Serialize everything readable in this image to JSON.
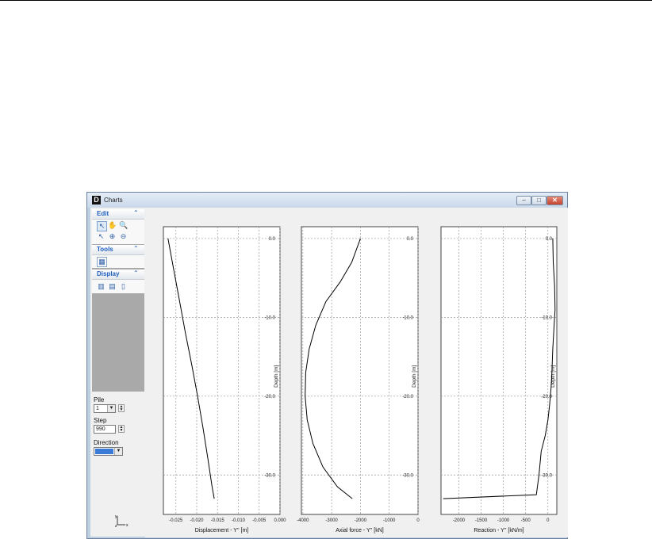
{
  "window": {
    "title": "Charts"
  },
  "panels": {
    "edit": {
      "label": "Edit",
      "chevron": "⌃"
    },
    "tools": {
      "label": "Tools",
      "chevron": "⌃"
    },
    "display": {
      "label": "Display",
      "chevron": "⌃"
    }
  },
  "controls": {
    "pile": {
      "label": "Pile",
      "value": "1"
    },
    "step": {
      "label": "Step",
      "value": "990"
    },
    "direction": {
      "label": "Direction",
      "value": ""
    }
  },
  "colors": {
    "selection": "#3b7bd8",
    "grid": "#9a9a9a",
    "line": "#000000"
  },
  "chart_data": [
    {
      "type": "line",
      "xlabel": "Displacement - Y'' [m]",
      "ylabel": "Depth [m]",
      "xlim": [
        -0.028,
        0.0
      ],
      "ylim": [
        -35.0,
        1.5
      ],
      "x_ticks": [
        -0.025,
        -0.02,
        -0.015,
        -0.01,
        -0.005,
        0.0
      ],
      "x_tick_labels": [
        "-0.025",
        "-0.020",
        "-0.015",
        "-0.010",
        "-0.005",
        "0.000"
      ],
      "y_ticks": [
        0,
        -10,
        -20,
        -30
      ],
      "y_tick_labels": [
        "0.0",
        "-10.0",
        "-20.0",
        "-30.0"
      ],
      "grid": true,
      "series": [
        {
          "x": [
            -0.0269,
            -0.0255,
            -0.0241,
            -0.0227,
            -0.0212,
            -0.0198,
            -0.0185,
            -0.0173,
            -0.0163,
            -0.0158
          ],
          "y": [
            0,
            -4,
            -8,
            -12,
            -16,
            -20,
            -24,
            -28,
            -31.5,
            -33.0
          ]
        }
      ]
    },
    {
      "type": "line",
      "xlabel": "Axial force - Y'' [kN]",
      "ylabel": "Depth [m]",
      "xlim": [
        -4050,
        0
      ],
      "ylim": [
        -35.0,
        1.5
      ],
      "x_ticks": [
        -4000,
        -3000,
        -2000,
        -1000,
        0
      ],
      "x_tick_labels": [
        "-4000",
        "-3000",
        "-2000",
        "-1000",
        "0"
      ],
      "y_ticks": [
        0,
        -10,
        -20,
        -30
      ],
      "y_tick_labels": [
        "0.0",
        "-10.0",
        "-20.0",
        "-30.0"
      ],
      "grid": true,
      "series": [
        {
          "x": [
            -2000,
            -2300,
            -2700,
            -3200,
            -3550,
            -3780,
            -3900,
            -3920,
            -3850,
            -3650,
            -3300,
            -2800,
            -2280
          ],
          "y": [
            0,
            -3,
            -5.5,
            -8,
            -11,
            -14,
            -17,
            -20,
            -23,
            -26,
            -29,
            -31.5,
            -33
          ]
        }
      ]
    },
    {
      "type": "line",
      "xlabel": "Reaction - Y'' [kN/m]",
      "ylabel": "Depth [m]",
      "xlim": [
        -2400,
        200
      ],
      "ylim": [
        -35.0,
        1.5
      ],
      "x_ticks": [
        -2000,
        -1500,
        -1000,
        -500,
        0
      ],
      "x_tick_labels": [
        "-2000",
        "-1500",
        "-1000",
        "-500",
        "0"
      ],
      "y_ticks": [
        0,
        -10,
        -20,
        -30
      ],
      "y_tick_labels": [
        "0.0",
        "-10.0",
        "-20.0",
        "-30.0"
      ],
      "grid": true,
      "series": [
        {
          "x": [
            110,
            120,
            150,
            160,
            140,
            110,
            90,
            70,
            40,
            0,
            -60,
            -150,
            -200,
            -260,
            -2350
          ],
          "y": [
            0,
            -3,
            -6,
            -9,
            -11,
            -14,
            -17,
            -19,
            -21,
            -23,
            -25,
            -27,
            -30,
            -32.5,
            -33.0
          ]
        }
      ]
    }
  ]
}
